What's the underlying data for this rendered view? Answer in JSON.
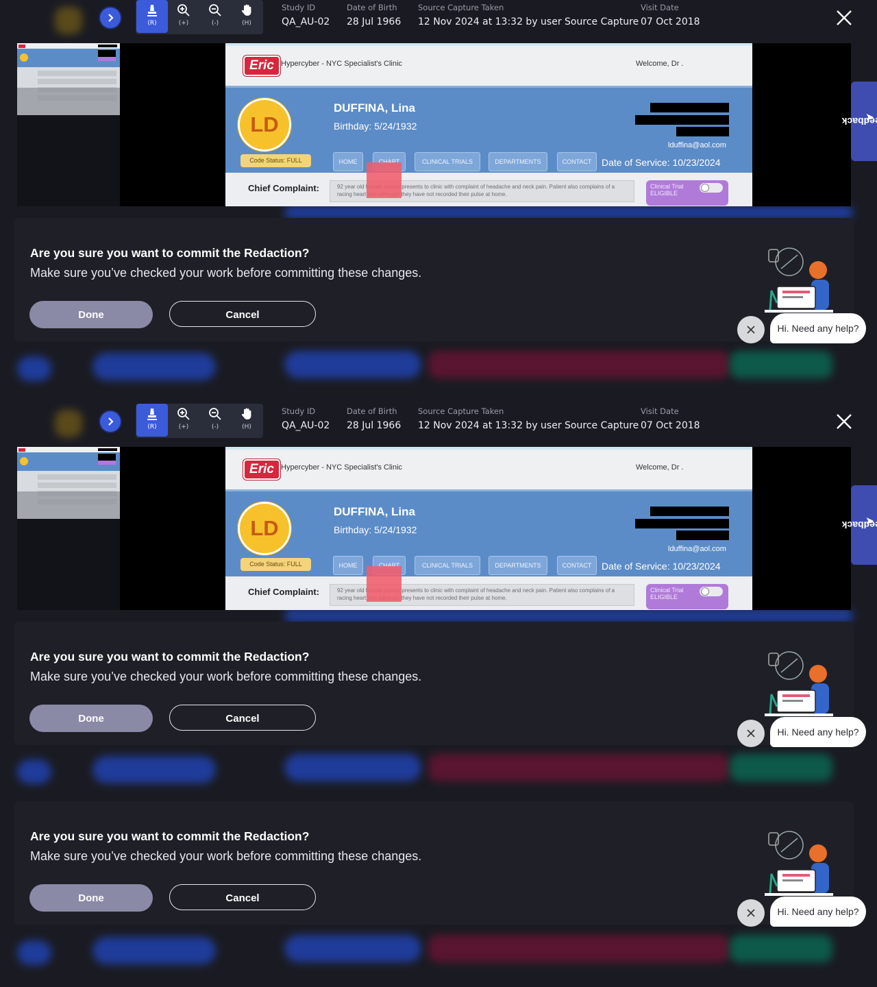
{
  "toolbar": {
    "tools": [
      {
        "name": "redact",
        "label": "(R)"
      },
      {
        "name": "zoom-in",
        "label": "(+)"
      },
      {
        "name": "zoom-out",
        "label": "(-)"
      },
      {
        "name": "pan",
        "label": "(H)"
      }
    ]
  },
  "meta": {
    "study_id_label": "Study ID",
    "study_id": "QA_AU-02",
    "dob_label": "Date of Birth",
    "dob": "28 Jul 1966",
    "capture_label": "Source Capture Taken",
    "capture": "12 Nov 2024 at 13:32 by user Source Capture",
    "visit_label": "Visit Date",
    "visit": "07 Oct 2018"
  },
  "document": {
    "logo": "Eric",
    "clinic": "Hypercyber - NYC Specialist's Clinic",
    "welcome": "Welcome, Dr .",
    "initials": "LD",
    "patient_name": "DUFFINA, Lina",
    "birthday": "Birthday:   5/24/1932",
    "email": "lduffina@aol.com",
    "code_status": "Code Status: FULL",
    "tabs": [
      "HOME",
      "CHART",
      "CLINICAL TRIALS",
      "DEPARTMENTS",
      "CONTACT"
    ],
    "date_of_service": "Date of Service: 10/23/2024",
    "cc_label": "Chief Complaint:",
    "cc_text": "92 year old female patient presents to clinic with complaint of headache and neck pain. Patient also complains of a racing heart rate although they have not recorded their pulse at home.",
    "clinical_trial": "Clinical Trial ELIGIBLE"
  },
  "confirm": {
    "title": "Are you sure you want to commit the Redaction?",
    "subtitle": "Make sure you’ve checked your work before committing these changes.",
    "done": "Done",
    "cancel": "Cancel"
  },
  "help": {
    "text": "Hi. Need any help?"
  },
  "feedback": {
    "label": "Feedback"
  },
  "colors": {
    "accent": "#3b5bdb",
    "done_button": "#8a8aa7",
    "redaction_mark": "#f15c6c",
    "feedback_tab": "#3f4db0"
  }
}
